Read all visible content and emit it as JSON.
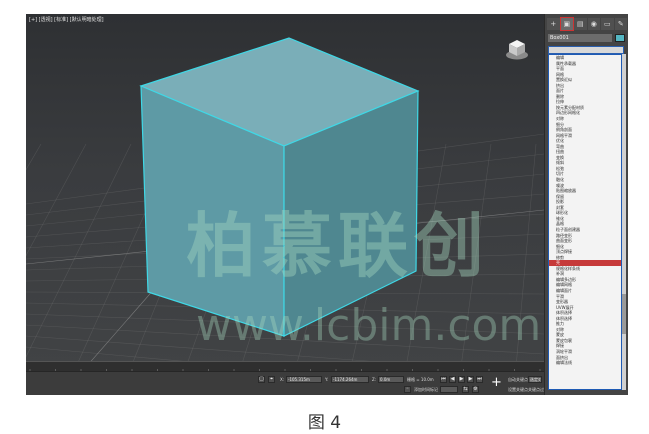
{
  "viewport": {
    "label": "[+] [透视] [标准] [默认明暗处理]",
    "object_color": "#63a2ad",
    "selection_color": "#3fd8e6"
  },
  "command_panel": {
    "tabs": [
      {
        "name": "create",
        "icon": "+"
      },
      {
        "name": "modify",
        "icon": "▣"
      },
      {
        "name": "hierarchy",
        "icon": "▤"
      },
      {
        "name": "motion",
        "icon": "◉"
      },
      {
        "name": "display",
        "icon": "▭"
      },
      {
        "name": "utilities",
        "icon": "✎"
      }
    ],
    "object_name": "Box001",
    "modifier_list": {
      "selected_index": 37,
      "items": [
        "编辑",
        "属性承载器",
        "平面",
        "网格",
        "置换近似",
        "挤出",
        "面片",
        "删除",
        "拉伸",
        "按元素分配材质",
        "四边形网格化",
        "对称",
        "细分",
        "倒角剖面",
        "网格平滑",
        "优化",
        "弯曲",
        "扭曲",
        "变换",
        "倾斜",
        "松弛",
        "切片",
        "融化",
        "噪波",
        "贴图缩放器",
        "保留",
        "投影",
        "封套",
        "球形化",
        "锥化",
        "晶格",
        "粒子面创建器",
        "路径变形",
        "曲面变形",
        "细化",
        "顶点焊接",
        "修剪",
        "壳",
        "规格化样条线",
        "补洞",
        "编辑多边形",
        "编辑网格",
        "编辑面片",
        "平滑",
        "变形器",
        "UVW展开",
        "体积选择",
        "体积选择",
        "推力",
        "对称",
        "蒙皮",
        "蒙皮包裹",
        "焊接",
        "涡轮平滑",
        "面挤出",
        "编辑法线"
      ]
    }
  },
  "status_bar": {
    "coord_x_label": "X:",
    "coord_x": "-105.315m",
    "coord_y_label": "Y:",
    "coord_y": "-1174.264m",
    "coord_z_label": "Z:",
    "coord_z": "0.0m",
    "grid_label": "栅格 = 10.0m",
    "add_time_tag": "添加时间标记",
    "auto_key": "自动关键点",
    "selected_label": "选定对象",
    "set_key": "设置关键点",
    "key_filters": "关键点过滤器"
  },
  "watermark": {
    "text": "柏慕联创",
    "url": "www.lcbim.com"
  },
  "caption": "图 4"
}
